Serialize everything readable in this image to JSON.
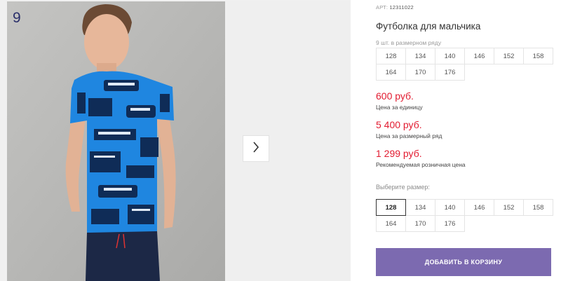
{
  "gallery": {
    "index": "9"
  },
  "product": {
    "art_label": "АРТ:",
    "art_value": "12311022",
    "title": "Футболка для мальчика",
    "pack_info": "9 шт. в размерном ряду",
    "pack_sizes": [
      "128",
      "134",
      "140",
      "146",
      "152",
      "158",
      "164",
      "170",
      "176"
    ],
    "prices": [
      {
        "value": "600 руб.",
        "note": "Цена за единицу"
      },
      {
        "value": "5 400 руб.",
        "note": "Цена за размерный ряд"
      },
      {
        "value": "1 299 руб.",
        "note": "Рекомендуемая розничная цена"
      }
    ],
    "choose_label": "Выберите размер:",
    "size_options": [
      "128",
      "134",
      "140",
      "146",
      "152",
      "158",
      "164",
      "170",
      "176"
    ],
    "selected_size": "128",
    "add_to_cart": "ДОБАВИТЬ В КОРЗИНУ"
  },
  "colors": {
    "accent": "#7c6ab0",
    "price": "#e21b30",
    "shirt": "#1f86e0",
    "shorts": "#1c2846"
  },
  "icons": {
    "next": "chevron-right-icon"
  }
}
